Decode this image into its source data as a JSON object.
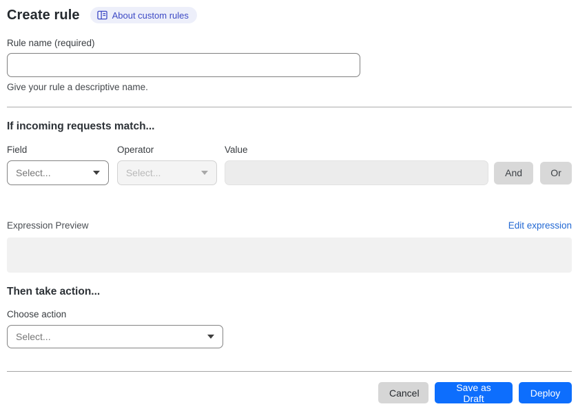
{
  "page": {
    "title": "Create rule"
  },
  "header": {
    "badge": {
      "label": "About custom rules",
      "icon": "book-icon"
    }
  },
  "rule_name": {
    "label": "Rule name (required)",
    "value": "",
    "helper": "Give your rule a descriptive name."
  },
  "match_section": {
    "heading": "If incoming requests match...",
    "field": {
      "label": "Field",
      "value": "Select..."
    },
    "operator": {
      "label": "Operator",
      "value": "Select..."
    },
    "value": {
      "label": "Value",
      "value": ""
    },
    "and_label": "And",
    "or_label": "Or"
  },
  "expression": {
    "label": "Expression Preview",
    "edit_link": "Edit expression",
    "content": ""
  },
  "action_section": {
    "heading": "Then take action...",
    "choose_label": "Choose action",
    "value": "Select..."
  },
  "footer": {
    "cancel": "Cancel",
    "save_draft": "Save as Draft",
    "deploy": "Deploy"
  },
  "colors": {
    "primary_blue": "#0d6efd",
    "link_blue": "#2268d3",
    "badge_bg": "#edeffa",
    "badge_text": "#3c49c5"
  }
}
